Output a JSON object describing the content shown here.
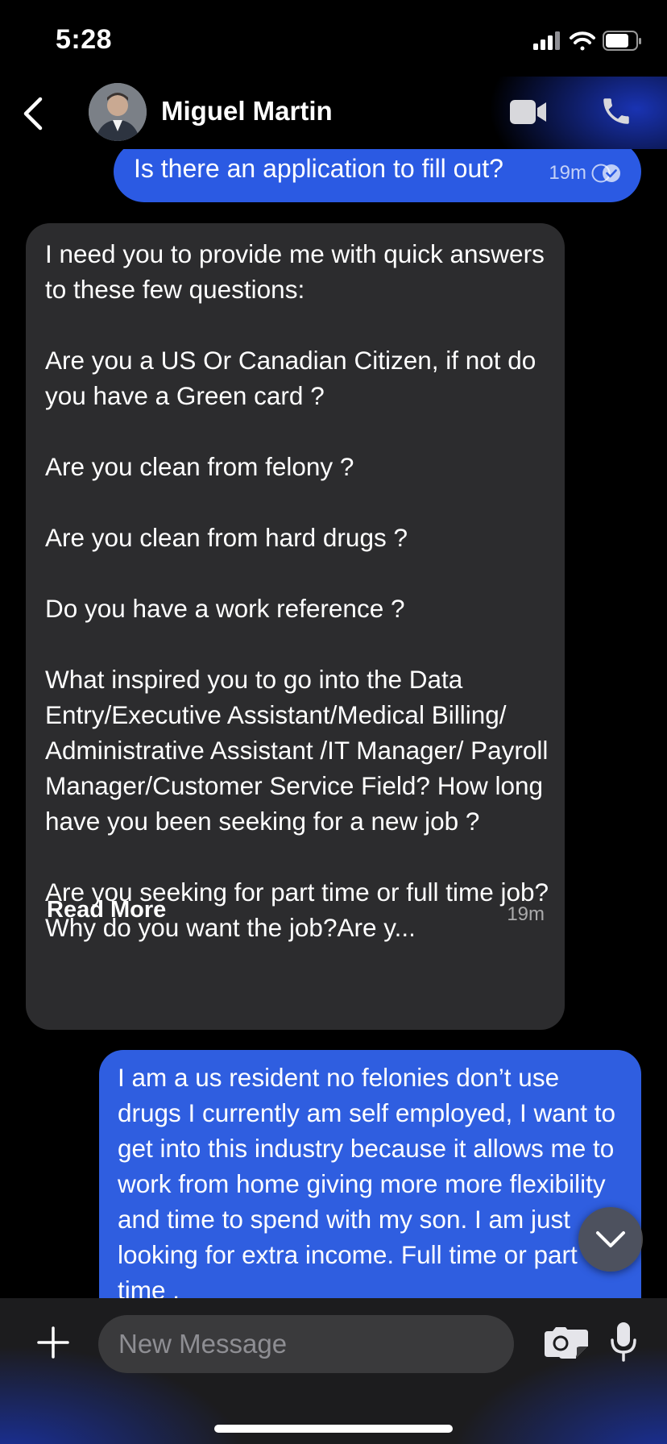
{
  "status_bar": {
    "time": "5:28"
  },
  "header": {
    "contact_name": "Miguel Martin"
  },
  "messages": [
    {
      "direction": "outgoing",
      "text": "Is there an application to fill out?",
      "time": "19m",
      "status": "read"
    },
    {
      "direction": "incoming",
      "text": "I need you to provide me with quick answers to these few questions:\n\nAre you a US Or Canadian Citizen, if not do you have a Green card ?\n\nAre you clean from felony ?\n\nAre you clean from hard drugs ?\n\nDo you have a work reference ?\n\nWhat inspired you to go into the Data Entry/Executive Assistant/Medical Billing/ Administrative Assistant /IT Manager/ Payroll Manager/Customer Service Field? How long have you been seeking for a new job ?\n\nAre you seeking for part time or full time job?Why do you want the job?Are y...",
      "read_more": "Read More",
      "time": "19m"
    },
    {
      "direction": "outgoing",
      "text": "I am a us resident no felonies don’t use drugs I currently am self employed, I want to get into this industry because it allows me to work from home giving more more flexibility and time to spend with my son. I am just looking for extra income. Full time or part time ."
    }
  ],
  "composer": {
    "placeholder": "New Message"
  },
  "colors": {
    "outgoing_bubble": "#2b5ae3",
    "incoming_bubble": "#2c2c2e",
    "background": "#000000"
  },
  "icons": [
    "signal-icon",
    "wifi-icon",
    "battery-icon",
    "back-chevron-icon",
    "video-call-icon",
    "phone-icon",
    "read-receipt-icon",
    "chevron-down-icon",
    "plus-icon",
    "sticker-icon",
    "camera-icon",
    "microphone-icon"
  ]
}
